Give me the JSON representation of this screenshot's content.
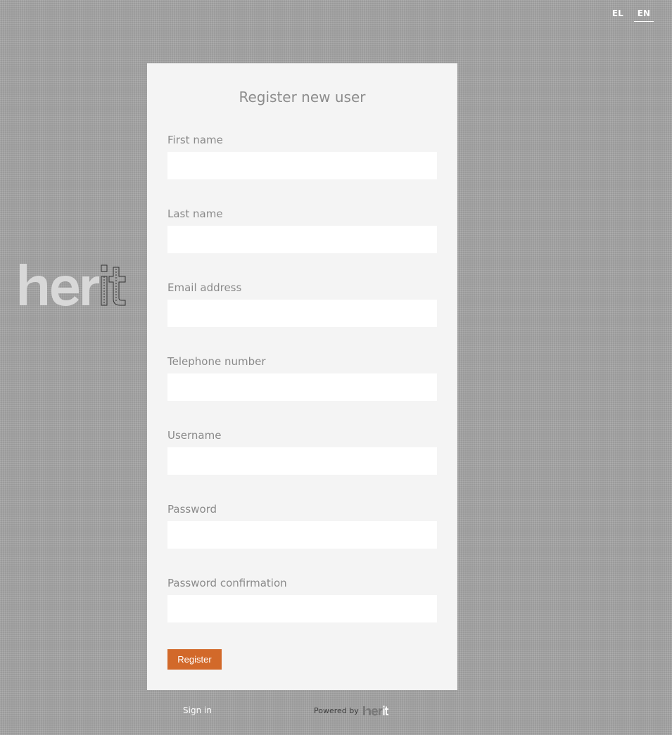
{
  "language_switch": {
    "items": [
      {
        "label": "EL",
        "active": false
      },
      {
        "label": "EN",
        "active": true
      }
    ]
  },
  "brand": {
    "logo_text": "herit",
    "logo_icon": "herit-logo"
  },
  "form": {
    "title": "Register new user",
    "fields": [
      {
        "label": "First name",
        "value": "",
        "placeholder": ""
      },
      {
        "label": "Last name",
        "value": "",
        "placeholder": ""
      },
      {
        "label": "Email address",
        "value": "",
        "placeholder": ""
      },
      {
        "label": "Telephone number",
        "value": "",
        "placeholder": ""
      },
      {
        "label": "Username",
        "value": "",
        "placeholder": ""
      },
      {
        "label": "Password",
        "value": "",
        "placeholder": ""
      },
      {
        "label": "Password confirmation",
        "value": "",
        "placeholder": ""
      }
    ],
    "submit_label": "Register"
  },
  "footer": {
    "signin_label": "Sign in",
    "powered_by_label": "Powered by",
    "powered_logo_text": "herit"
  },
  "colors": {
    "accent": "#d2692a",
    "card_background": "#f4f4f4",
    "page_background": "#9a9a9a"
  }
}
